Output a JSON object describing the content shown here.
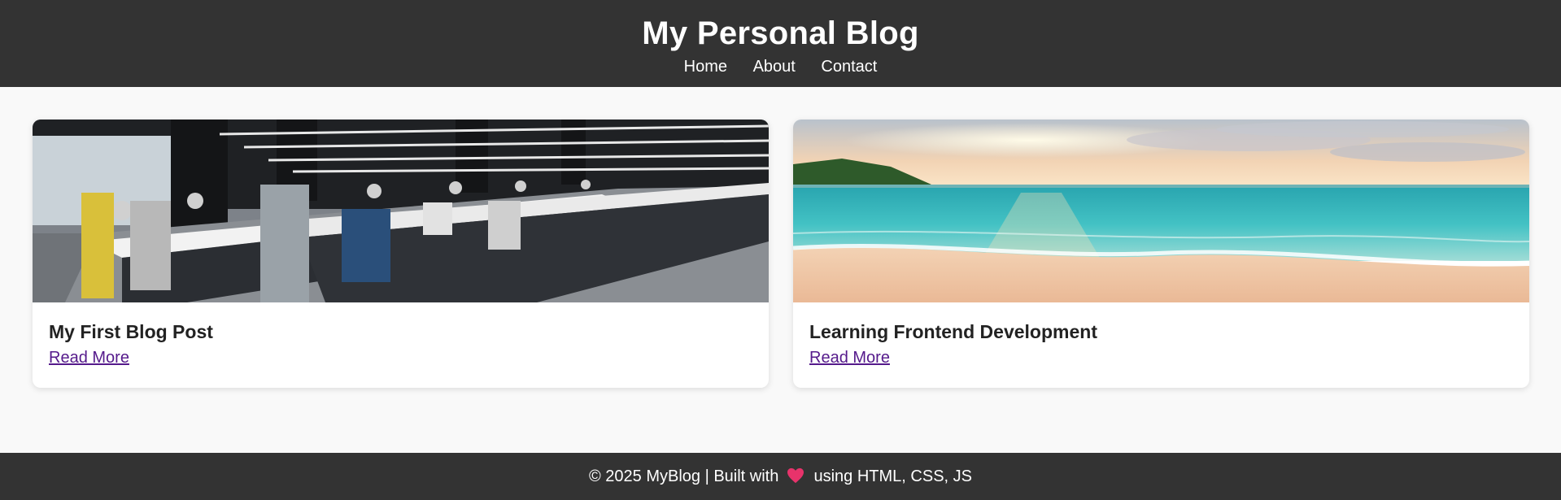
{
  "header": {
    "title": "My Personal Blog",
    "nav": [
      "Home",
      "About",
      "Contact"
    ]
  },
  "posts": [
    {
      "title": "My First Blog Post",
      "link_label": "Read More",
      "image": "office-workspace-photo"
    },
    {
      "title": "Learning Frontend Development",
      "link_label": "Read More",
      "image": "beach-sunset-photo"
    }
  ],
  "footer": {
    "text_before": "© 2025 MyBlog | Built with",
    "icon": "heart-icon",
    "text_after": "using HTML, CSS, JS"
  },
  "colors": {
    "header_bg": "#333333",
    "page_bg": "#f9f9f9",
    "link": "#551a8b",
    "heart": "#e8336b"
  }
}
